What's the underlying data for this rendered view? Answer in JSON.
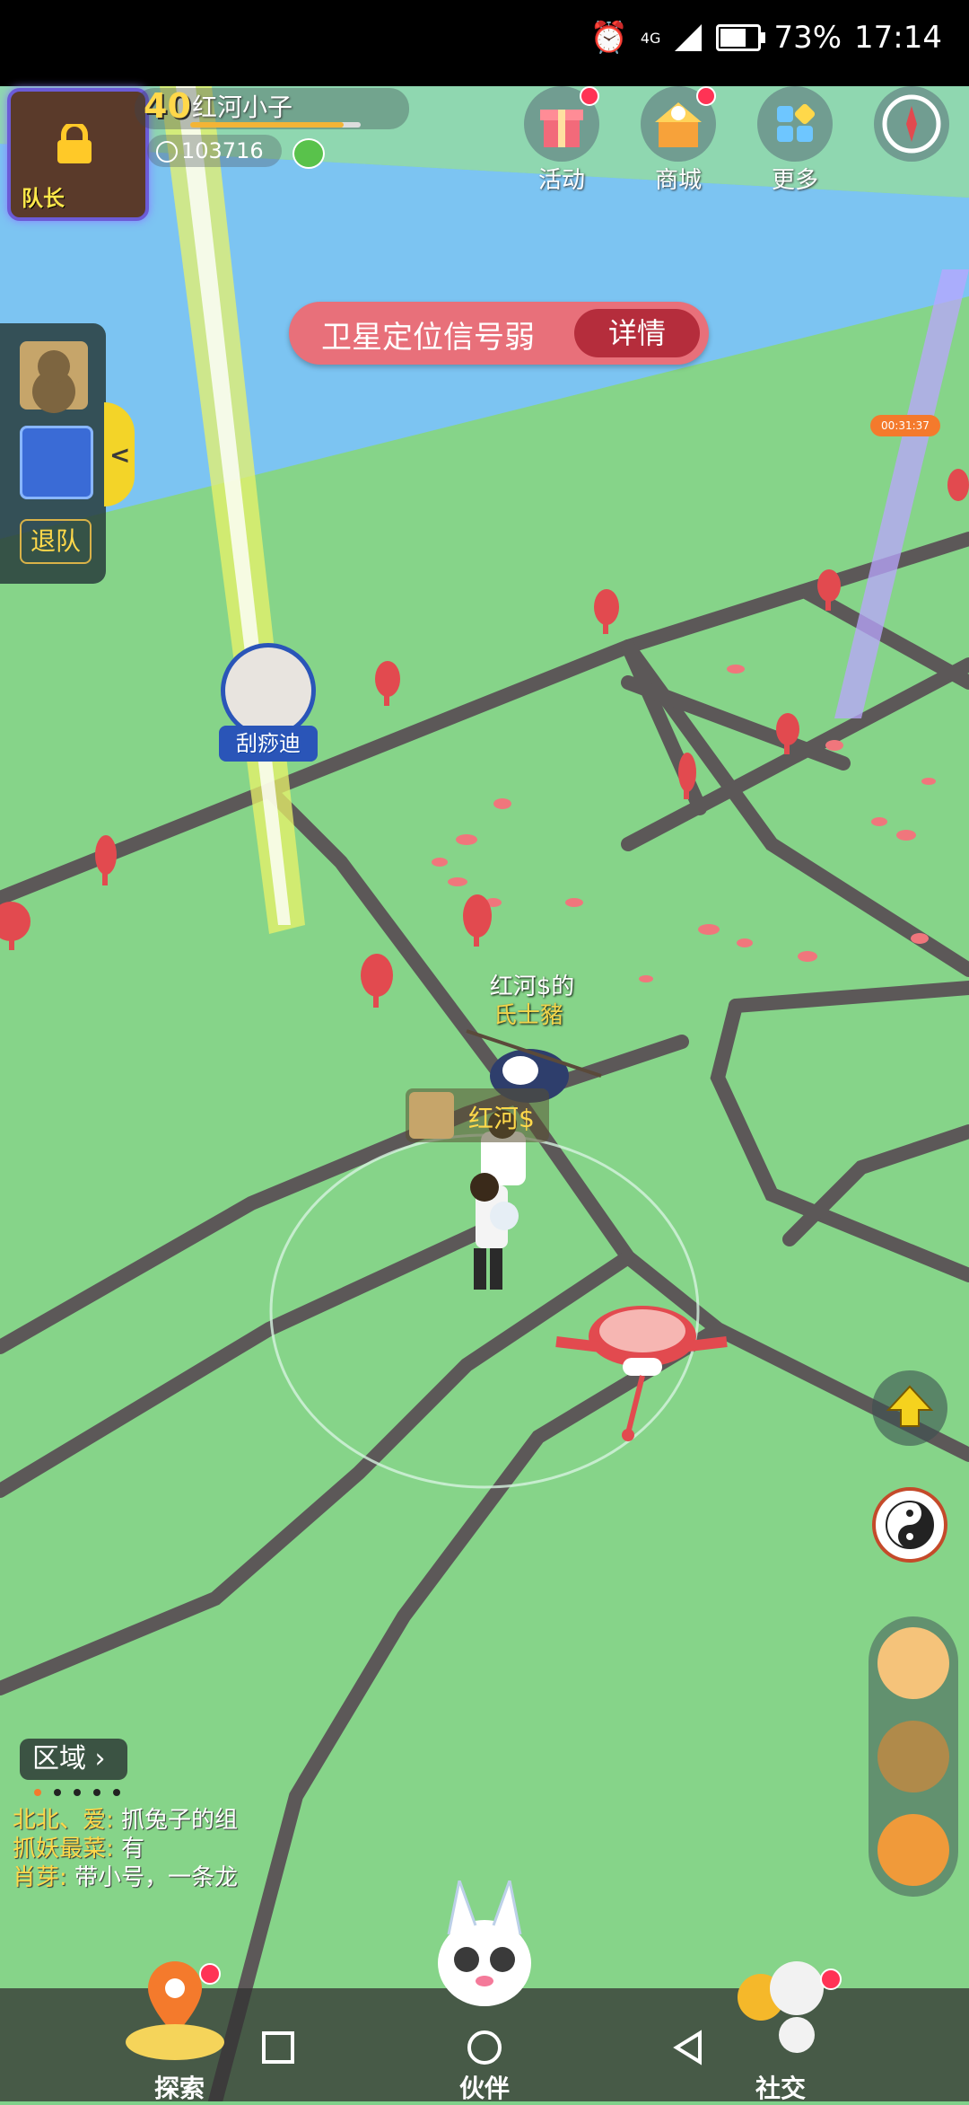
{
  "status_bar": {
    "battery": "73%",
    "time": "17:14",
    "network": "4G",
    "battery_level": 0.73
  },
  "player": {
    "level": "40",
    "name": "红河小子",
    "coins": "103716",
    "captain_badge": "队长",
    "xp_fraction": 0.9
  },
  "top_actions": [
    {
      "label": "活动",
      "icon": "gift-icon"
    },
    {
      "label": "商城",
      "icon": "shop-icon"
    },
    {
      "label": "更多",
      "icon": "more-grid-icon"
    },
    {
      "label": "",
      "icon": "compass-icon"
    }
  ],
  "banner": {
    "message": "卫星定位信号弱",
    "button": "详情"
  },
  "team": {
    "leave_label": "退队",
    "collapse_icon": "<"
  },
  "timer_chip": "00:31:37",
  "map_labels": {
    "rival_name": "刮痧迪",
    "companion_name": "红河$的",
    "companion_sub": "氏士豬",
    "player_tag": "红河$"
  },
  "chat": {
    "region_label": "区域",
    "lines": [
      {
        "who": "北北、爱:",
        "msg": " 抓兔子的组"
      },
      {
        "who": "抓妖最菜:",
        "msg": " 有"
      },
      {
        "who": "肖芽:",
        "msg": " 带小号，一条龙"
      }
    ]
  },
  "bottom_nav": {
    "explore": "探索",
    "partner": "伙伴",
    "social": "社交"
  },
  "colors": {
    "map_ground": "#86d489",
    "road": "#5c5858",
    "river": "#7cc4f2",
    "banner": "#e8707a",
    "accent_gold": "#ffd84a"
  }
}
